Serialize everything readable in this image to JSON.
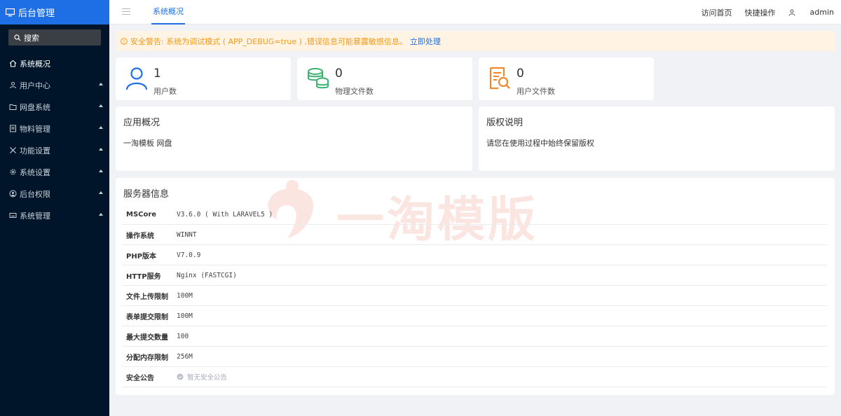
{
  "sidebar": {
    "brand": "后台管理",
    "search_label": "搜索",
    "items": [
      {
        "label": "系统概况",
        "icon": "home-icon",
        "active": true
      },
      {
        "label": "用户中心",
        "icon": "users-icon"
      },
      {
        "label": "网盘系统",
        "icon": "folder-icon"
      },
      {
        "label": "物料管理",
        "icon": "document-icon"
      },
      {
        "label": "功能设置",
        "icon": "tools-icon"
      },
      {
        "label": "系统设置",
        "icon": "gear-icon"
      },
      {
        "label": "后台权限",
        "icon": "user-circle-icon"
      },
      {
        "label": "系统管理",
        "icon": "keyboard-icon"
      }
    ]
  },
  "header": {
    "active_tab": "系统概况",
    "links": {
      "visit_home": "访问首页",
      "quick_ops": "快捷操作",
      "user": "admin"
    }
  },
  "alert": {
    "text": "安全警告: 系统为调试模式 ( APP_DEBUG=true ) ,错误信息可能暴露敏感信息。",
    "action": "立即处理"
  },
  "stats": [
    {
      "value": "1",
      "label": "用户数",
      "icon": "user-icon",
      "color": "#1e6fe6"
    },
    {
      "value": "0",
      "label": "物理文件数",
      "icon": "database-icon",
      "color": "#3cb371"
    },
    {
      "value": "0",
      "label": "用户文件数",
      "icon": "file-search-icon",
      "color": "#f0892b"
    }
  ],
  "app_overview": {
    "title": "应用概况",
    "body": "一淘模板 网盘"
  },
  "copyright": {
    "title": "版权说明",
    "body": "请您在使用过程中始终保留版权"
  },
  "server": {
    "title": "服务器信息",
    "watermark": "一淘模版",
    "rows": [
      {
        "key": "MSCore",
        "value": "V3.6.0 ( With LARAVEL5 )"
      },
      {
        "key": "操作系统",
        "value": "WINNT"
      },
      {
        "key": "PHP版本",
        "value": "V7.0.9"
      },
      {
        "key": "HTTP服务",
        "value": "Nginx (FASTCGI)"
      },
      {
        "key": "文件上传限制",
        "value": "100M"
      },
      {
        "key": "表单提交限制",
        "value": "100M"
      },
      {
        "key": "最大提交数量",
        "value": "100"
      },
      {
        "key": "分配内存限制",
        "value": "256M"
      },
      {
        "key": "安全公告",
        "value": "暂无安全公告"
      }
    ]
  },
  "colors": {
    "primary": "#1e6fe6",
    "sidebar_bg": "#001529",
    "warning": "#f09a1c",
    "warning_bg": "#fff4e3"
  }
}
